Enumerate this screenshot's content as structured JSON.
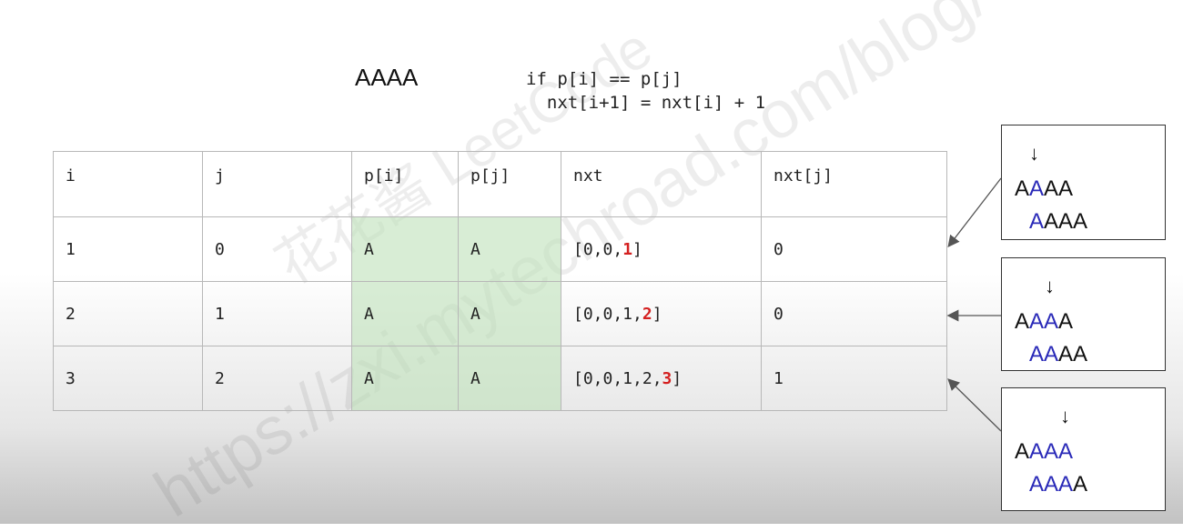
{
  "pattern_text": "AAAA",
  "code_lines": [
    "if p[i] == p[j]",
    "  nxt[i+1] = nxt[i] + 1"
  ],
  "table": {
    "headers": [
      "i",
      "j",
      "p[i]",
      "p[j]",
      "nxt",
      "nxt[j]"
    ],
    "rows": [
      {
        "i": "1",
        "j": "0",
        "pi": "A",
        "pj": "A",
        "nxt_prefix": "[0,0,",
        "nxt_highlight": "1",
        "nxt_suffix": "]",
        "nxtj": "0"
      },
      {
        "i": "2",
        "j": "1",
        "pi": "A",
        "pj": "A",
        "nxt_prefix": "[0,0,1,",
        "nxt_highlight": "2",
        "nxt_suffix": "]",
        "nxtj": "0"
      },
      {
        "i": "3",
        "j": "2",
        "pi": "A",
        "pj": "A",
        "nxt_prefix": "[0,0,1,2,",
        "nxt_highlight": "3",
        "nxt_suffix": "]",
        "nxtj": "1"
      }
    ]
  },
  "boxes": [
    {
      "arrow": "↓",
      "top_black_a": "A",
      "top_blue": "A",
      "top_black_b": "AA",
      "bottom_blue": "A",
      "bottom_black": "AAA"
    },
    {
      "arrow": "↓",
      "top_black_a": "A",
      "top_blue": "AA",
      "top_black_b": "A",
      "bottom_blue": "AA",
      "bottom_black": "AA"
    },
    {
      "arrow": "↓",
      "top_black_a": "A",
      "top_blue": "AAA",
      "top_black_b": "",
      "bottom_blue": "AAA",
      "bottom_black": "A"
    }
  ],
  "watermark": {
    "text_main": "花花酱 LeetCode",
    "text_url": "https://zxi.mytechroad.com/blog/"
  },
  "colors": {
    "highlight_red": "#d42020",
    "match_blue": "#2a2ab8",
    "cell_green": "#c9e5c3"
  }
}
